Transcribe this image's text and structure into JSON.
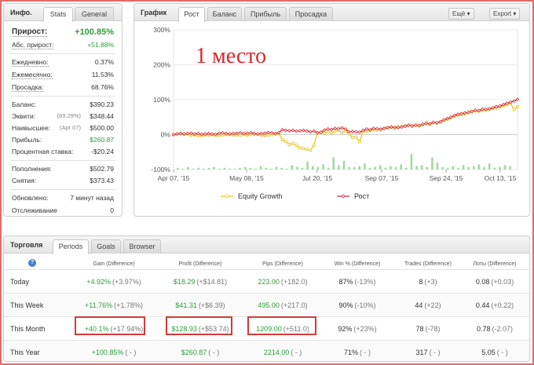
{
  "info_panel": {
    "title": "Инфо.",
    "tabs": [
      "Stats",
      "General"
    ],
    "gain_label": "Прирост:",
    "gain_value": "+100.85%",
    "abs_gain_label": "Абс. прирост:",
    "abs_gain_value": "+51.88%",
    "daily_label": "Ежедневно:",
    "daily_value": "0.37%",
    "monthly_label": "Ежемесячно:",
    "monthly_value": "11.53%",
    "drawdown_label": "Просадка:",
    "drawdown_value": "68.76%",
    "balance_label": "Баланс:",
    "balance_value": "$390.23",
    "equity_label": "Эквити:",
    "equity_pct": "(89.29%)",
    "equity_value": "$348.44",
    "highest_label": "Наивысшее:",
    "highest_date": "(Apr 07)",
    "highest_value": "$500.00",
    "profit_label": "Прибыль:",
    "profit_value": "$260.87",
    "interest_label": "Процентная ставка:",
    "interest_value": "-$20.24",
    "deposits_label": "Пополнения:",
    "deposits_value": "$502.79",
    "withdrawals_label": "Снятия:",
    "withdrawals_value": "$373.43",
    "updated_label": "Обновлено:",
    "updated_value": "7 минут назад",
    "tracking_label": "Отслеживание",
    "tracking_value": "0"
  },
  "chart_panel": {
    "title": "График",
    "tabs": [
      "Рост",
      "Баланс",
      "Прибыль",
      "Просадка"
    ],
    "btn_mode": "Ещё",
    "btn_export": "Export",
    "annotation": "1 место"
  },
  "chart_data": {
    "type": "line",
    "y_ticks": [
      "300%",
      "200%",
      "100%",
      "0%",
      "-100%"
    ],
    "ylim": [
      -100,
      300
    ],
    "x_ticks": [
      "Apr 07, '15",
      "May 08, '15",
      "Jul 20, '15",
      "Sep 07, '15",
      "Sep 24, '15",
      "Oct 13, '15"
    ],
    "legend": [
      "Equity Growth",
      "Рост"
    ],
    "series": [
      {
        "name": "Рост",
        "color": "#d9262e",
        "values": [
          0,
          2,
          3,
          2,
          3,
          4,
          2,
          3,
          1,
          2,
          3,
          2,
          1,
          4,
          5,
          3,
          2,
          3,
          4,
          5,
          3,
          4,
          5,
          3,
          2,
          3,
          4,
          6,
          5,
          3,
          6,
          14,
          12,
          11,
          12,
          10,
          11,
          12,
          10,
          8,
          10,
          6,
          7,
          13,
          16,
          15,
          18,
          17,
          19,
          16,
          8,
          9,
          8,
          7,
          12,
          16,
          14,
          18,
          17,
          15,
          18,
          20,
          22,
          19,
          21,
          22,
          24,
          27,
          25,
          27,
          26,
          30,
          32,
          31,
          35,
          34,
          37,
          42,
          46,
          50,
          55,
          58,
          60,
          62,
          64,
          66,
          70,
          69,
          73,
          72,
          74,
          77,
          80,
          82,
          86,
          90,
          93,
          96,
          101
        ]
      },
      {
        "name": "Equity Growth",
        "color": "#e9c21a",
        "values": [
          0,
          2,
          3,
          1,
          2,
          -2,
          -1,
          -3,
          -4,
          -1,
          -2,
          0,
          -3,
          -2,
          -1,
          0,
          1,
          -1,
          -2,
          -1,
          0,
          -1,
          0,
          2,
          1,
          -1,
          -3,
          -2,
          0,
          2,
          4,
          -15,
          -20,
          -28,
          -25,
          -30,
          -38,
          -40,
          -42,
          -45,
          -30,
          5,
          6,
          4,
          8,
          5,
          10,
          12,
          6,
          10,
          2,
          -8,
          -7,
          -20,
          8,
          10,
          12,
          15,
          13,
          16,
          18,
          20,
          21,
          22,
          20,
          23,
          25,
          27,
          24,
          27,
          25,
          29,
          33,
          30,
          34,
          33,
          36,
          41,
          44,
          48,
          53,
          56,
          58,
          60,
          63,
          66,
          68,
          67,
          70,
          71,
          73,
          75,
          76,
          79,
          83,
          86,
          90,
          72,
          80
        ]
      }
    ],
    "volume_bars": [
      2,
      1,
      3,
      1,
      2,
      1,
      2,
      3,
      1,
      2,
      1,
      1,
      2,
      3,
      2,
      1,
      4,
      2,
      1,
      3,
      2,
      1,
      5,
      3,
      2,
      9,
      4,
      3,
      6,
      2,
      14,
      5,
      10,
      3,
      3,
      4,
      7,
      2,
      3,
      5,
      2,
      4,
      3,
      6,
      2,
      18,
      4,
      5,
      3,
      14,
      8,
      3,
      2,
      4,
      2,
      5,
      3,
      4,
      6,
      3,
      7,
      2,
      3,
      5,
      4
    ]
  },
  "trading_panel": {
    "title": "Торговля",
    "tabs": [
      "Periods",
      "Goals",
      "Browser"
    ],
    "help_icon": "?",
    "columns": [
      "Gain (Difference)",
      "Profit (Difference)",
      "Pips (Difference)",
      "Win % (Difference)",
      "Trades (Difference)",
      "Лоты (Difference)"
    ],
    "rows": [
      {
        "label": "Today",
        "gain": "+4.92%",
        "gain_d": "(+3.97%)",
        "profit": "$18.29",
        "profit_d": "(+$14.81)",
        "pips": "223.00",
        "pips_d": "(+182.0)",
        "win": "87%",
        "win_d": "(-13%)",
        "trades": "8",
        "trades_d": "(+3)",
        "lots": "0.08",
        "lots_d": "(+0.03)"
      },
      {
        "label": "This Week",
        "gain": "+11.76%",
        "gain_d": "(+1.78%)",
        "profit": "$41.31",
        "profit_d": "(+$6.39)",
        "pips": "495.00",
        "pips_d": "(+217.0)",
        "win": "90%",
        "win_d": "(-10%)",
        "trades": "44",
        "trades_d": "(+22)",
        "lots": "0.44",
        "lots_d": "(+0.22)"
      },
      {
        "label": "This Month",
        "gain": "+40.1%",
        "gain_d": "(+17.94%)",
        "profit": "$128.93",
        "profit_d": "(+$53.74)",
        "pips": "1209.00",
        "pips_d": "(+511.0)",
        "win": "92%",
        "win_d": "(+23%)",
        "trades": "78",
        "trades_d": "(-78)",
        "lots": "0.78",
        "lots_d": "(-2.07)"
      },
      {
        "label": "This Year",
        "gain": "+100.85%",
        "gain_d": "( - )",
        "profit": "$260.87",
        "profit_d": "( - )",
        "pips": "2214.00",
        "pips_d": "( - )",
        "win": "71%",
        "win_d": "( - )",
        "trades": "317",
        "trades_d": "( - )",
        "lots": "5.05",
        "lots_d": "( - )"
      }
    ]
  }
}
